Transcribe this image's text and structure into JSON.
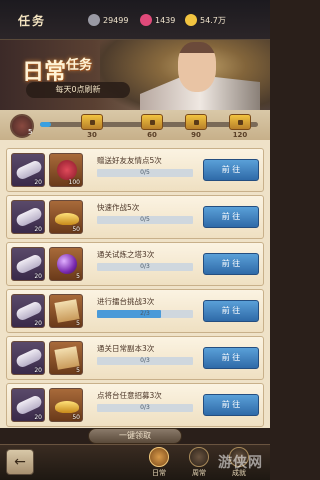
{
  "topbar": {
    "title": "任务",
    "resources": [
      {
        "icon": "sword-currency-icon",
        "value": "29499",
        "color": "#cfc9c5"
      },
      {
        "icon": "diamond-icon",
        "value": "1439",
        "color": "#e04a7a"
      },
      {
        "icon": "gold-coin-icon",
        "value": "54.7万",
        "color": "#f2c440"
      }
    ]
  },
  "banner": {
    "title_main": "日常",
    "title_sub": "任务",
    "refresh_note": "每天0点刷新"
  },
  "activity": {
    "current": "5",
    "progress_fraction": 0.05,
    "chests": [
      {
        "value": "30"
      },
      {
        "value": "60"
      },
      {
        "value": "90"
      },
      {
        "value": "120"
      }
    ]
  },
  "tasks": [
    {
      "name": "赠送好友友情点5次",
      "progress": "0/5",
      "fraction": 0.0,
      "reward1": "20",
      "reward2": "100",
      "art2": "rose",
      "button": "前 往"
    },
    {
      "name": "快速作战5次",
      "progress": "0/5",
      "fraction": 0.0,
      "reward1": "20",
      "reward2": "50",
      "art2": "gold",
      "button": "前 往"
    },
    {
      "name": "通关试炼之塔3次",
      "progress": "0/3",
      "fraction": 0.0,
      "reward1": "20",
      "reward2": "5",
      "art2": "orb",
      "button": "前 往"
    },
    {
      "name": "进行擂台挑战3次",
      "progress": "2/3",
      "fraction": 0.67,
      "reward1": "20",
      "reward2": "5",
      "art2": "paper",
      "button": "前 往"
    },
    {
      "name": "通关日常副本3次",
      "progress": "0/3",
      "fraction": 0.0,
      "reward1": "20",
      "reward2": "5",
      "art2": "paper",
      "button": "前 往"
    },
    {
      "name": "点将台任意招募3次",
      "progress": "0/3",
      "fraction": 0.0,
      "reward1": "20",
      "reward2": "50",
      "art2": "gold",
      "button": "前 往"
    }
  ],
  "claim_all": "一键领取",
  "nav": {
    "back": "←",
    "tabs": [
      {
        "label": "日常",
        "active": true
      },
      {
        "label": "周常",
        "active": false
      },
      {
        "label": "成就",
        "active": false
      }
    ]
  },
  "watermark": "游侠网"
}
